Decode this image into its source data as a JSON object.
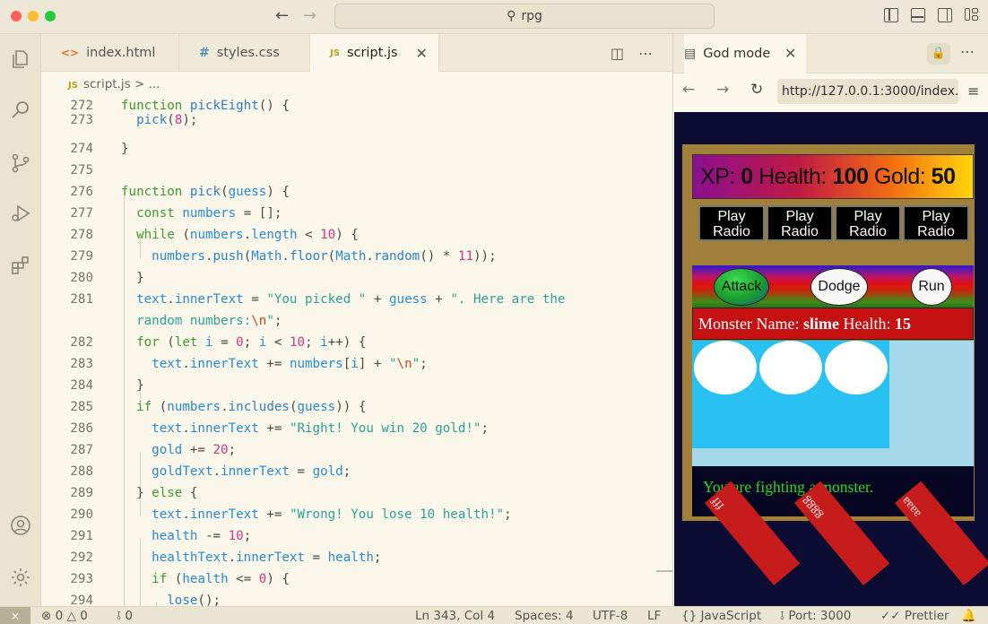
{
  "window": {
    "command_center": "rpg"
  },
  "editor": {
    "tabs": [
      {
        "icon": "<>",
        "label": "index.html"
      },
      {
        "icon": "#",
        "label": "styles.css"
      },
      {
        "icon": "JS",
        "label": "script.js",
        "active": true
      }
    ],
    "breadcrumb": {
      "file": "script.js",
      "rest": "> ..."
    },
    "lines": [
      {
        "n": "272",
        "html": "<span class='kw'>function</span> <span class='fn'>pickEight</span>() {"
      },
      {
        "n": "273",
        "html": "  <span class='fn'>pick</span>(<span class='num'>8</span>);"
      },
      {
        "n": "274",
        "html": "}"
      },
      {
        "n": "275",
        "html": ""
      },
      {
        "n": "276",
        "html": "<span class='kw'>function</span> <span class='fn'>pick</span>(<span class='var'>guess</span>) {"
      },
      {
        "n": "277",
        "html": "  <span class='kw'>const</span> <span class='var'>numbers</span> = [];"
      },
      {
        "n": "278",
        "html": "  <span class='kw'>while</span> (<span class='var'>numbers</span>.<span class='var'>length</span> &lt; <span class='num'>10</span>) {"
      },
      {
        "n": "279",
        "html": "    <span class='var'>numbers</span>.<span class='fn'>push</span>(<span class='var'>Math</span>.<span class='fn'>floor</span>(<span class='var'>Math</span>.<span class='fn'>random</span>() * <span class='num'>11</span>));"
      },
      {
        "n": "280",
        "html": "  }"
      },
      {
        "n": "281",
        "html": "  <span class='var'>text</span>.<span class='var'>innerText</span> = <span class='str'>\"You picked \"</span> + <span class='var'>guess</span> + <span class='str'>\". Here are the</span>"
      },
      {
        "n": "",
        "html": "  <span class='str'>random numbers:</span><span class='esc'>\\n</span><span class='str'>\"</span>;"
      },
      {
        "n": "282",
        "html": "  <span class='kw'>for</span> (<span class='kw'>let</span> <span class='var'>i</span> = <span class='num'>0</span>; <span class='var'>i</span> &lt; <span class='num'>10</span>; <span class='var'>i</span>++) {"
      },
      {
        "n": "283",
        "html": "    <span class='var'>text</span>.<span class='var'>innerText</span> += <span class='var'>numbers</span>[<span class='var'>i</span>] + <span class='str'>\"</span><span class='esc'>\\n</span><span class='str'>\"</span>;"
      },
      {
        "n": "284",
        "html": "  }"
      },
      {
        "n": "285",
        "html": "  <span class='kw'>if</span> (<span class='var'>numbers</span>.<span class='fn'>includes</span>(<span class='var'>guess</span>)) {"
      },
      {
        "n": "286",
        "html": "    <span class='var'>text</span>.<span class='var'>innerText</span> += <span class='str'>\"Right! You win 20 gold!\"</span>;"
      },
      {
        "n": "287",
        "html": "    <span class='var'>gold</span> += <span class='num'>20</span>;"
      },
      {
        "n": "288",
        "html": "    <span class='var'>goldText</span>.<span class='var'>innerText</span> = <span class='var'>gold</span>;"
      },
      {
        "n": "289",
        "html": "  } <span class='kw'>else</span> {"
      },
      {
        "n": "290",
        "html": "    <span class='var'>text</span>.<span class='var'>innerText</span> += <span class='str'>\"Wrong! You lose 10 health!\"</span>;"
      },
      {
        "n": "291",
        "html": "    <span class='var'>health</span> -= <span class='num'>10</span>;"
      },
      {
        "n": "292",
        "html": "    <span class='var'>healthText</span>.<span class='var'>innerText</span> = <span class='var'>health</span>;"
      },
      {
        "n": "293",
        "html": "    <span class='kw'>if</span> (<span class='var'>health</span> &lt;= <span class='num'>0</span>) {"
      },
      {
        "n": "294",
        "html": "      <span class='fn'>lose</span>();"
      }
    ]
  },
  "browser": {
    "tab_label": "God mode",
    "url": "http://127.0.0.1:3000/index.html",
    "game": {
      "xp_label": "XP:",
      "xp": "0",
      "health_label": "Health:",
      "health": "100",
      "gold_label": "Gold:",
      "gold": "50",
      "radio_buttons": [
        "Play\nRadio",
        "Play\nRadio",
        "Play\nRadio",
        "Play\nRadio"
      ],
      "attack": "Attack",
      "dodge": "Dodge",
      "run": "Run",
      "monster_name_label": "Monster Name:",
      "monster_name": "slime",
      "monster_health_label": "Health:",
      "monster_health": "15",
      "message": "You are fighting a monster.",
      "slabs": [
        "fff",
        "gggg",
        "aaaa"
      ]
    }
  },
  "statusbar": {
    "errors": "0",
    "warnings": "0",
    "ports_count": "0",
    "position": "Ln 343, Col 4",
    "spaces": "Spaces: 4",
    "encoding": "UTF-8",
    "eol": "LF",
    "language": "JavaScript",
    "port": "Port: 3000",
    "formatter": "Prettier"
  }
}
